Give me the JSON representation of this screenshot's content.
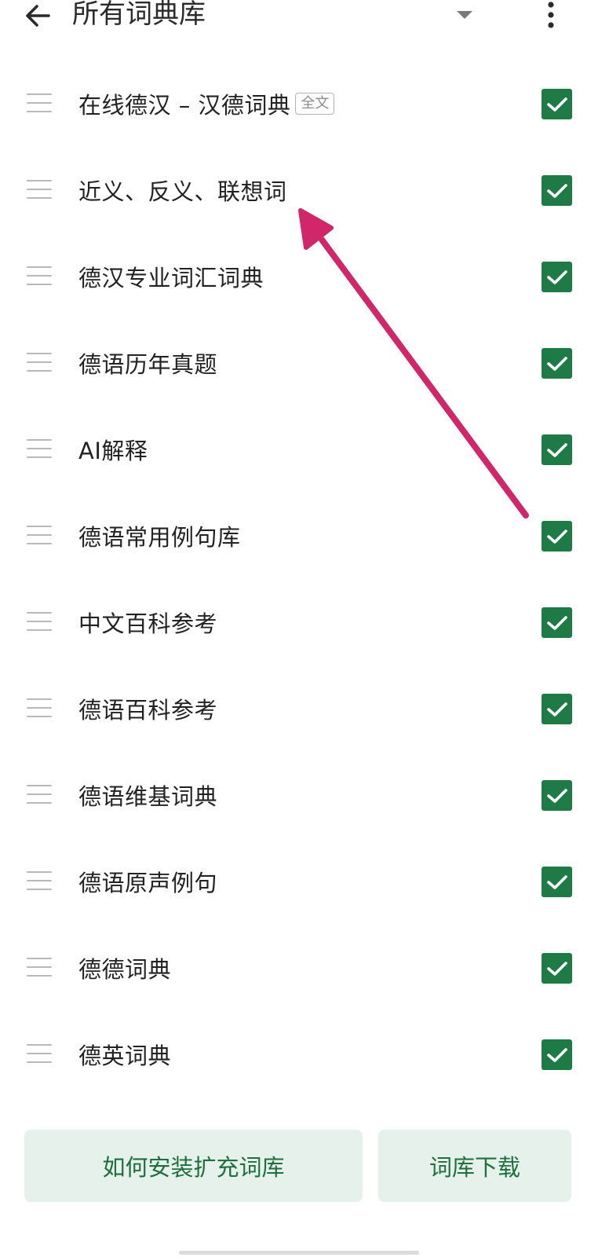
{
  "header": {
    "title": "所有词典库",
    "back_icon": "arrow-left-icon",
    "dropdown_icon": "caret-down-icon",
    "more_icon": "more-vertical-icon"
  },
  "dictionaries": [
    {
      "label": "在线德汉 – 汉德词典",
      "tag": "全文",
      "checked": true
    },
    {
      "label": "近义、反义、联想词",
      "checked": true
    },
    {
      "label": "德汉专业词汇词典",
      "checked": true
    },
    {
      "label": "德语历年真题",
      "checked": true
    },
    {
      "label": "AI解释",
      "checked": true
    },
    {
      "label": "德语常用例句库",
      "checked": true
    },
    {
      "label": "中文百科参考",
      "checked": true
    },
    {
      "label": "德语百科参考",
      "checked": true
    },
    {
      "label": "德语维基词典",
      "checked": true
    },
    {
      "label": "德语原声例句",
      "checked": true
    },
    {
      "label": "德德词典",
      "checked": true
    },
    {
      "label": "德英词典",
      "checked": true
    }
  ],
  "bottom": {
    "install_label": "如何安装扩充词库",
    "download_label": "词库下载"
  },
  "colors": {
    "accent": "#1e7b45",
    "button_bg": "#e5f1ea",
    "button_text": "#1e6e3e",
    "annotation_arrow": "#d0276a"
  }
}
